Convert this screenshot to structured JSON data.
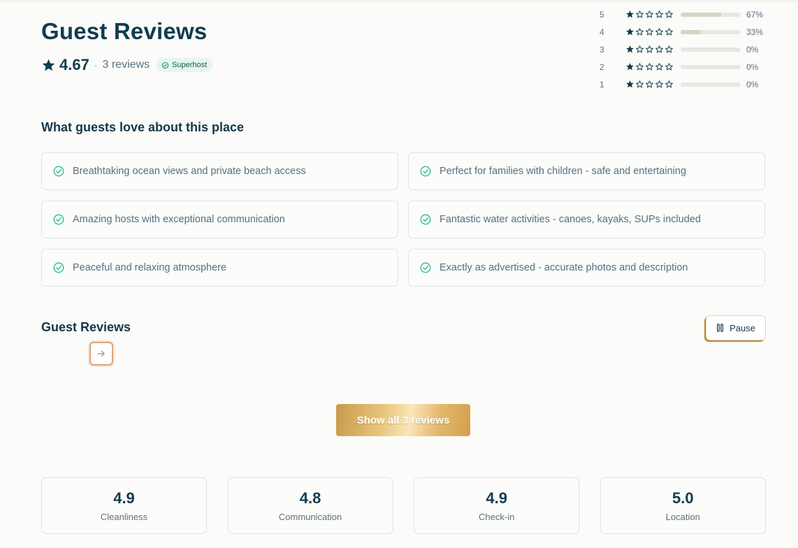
{
  "header": {
    "title": "Guest Reviews",
    "rating": "4.67",
    "separator": "·",
    "reviews_count": "3 reviews",
    "badge": "Superhost"
  },
  "distribution": [
    {
      "stars": "5",
      "percent_label": "67%",
      "fraction": 0.67
    },
    {
      "stars": "4",
      "percent_label": "33%",
      "fraction": 0.33
    },
    {
      "stars": "3",
      "percent_label": "0%",
      "fraction": 0
    },
    {
      "stars": "2",
      "percent_label": "0%",
      "fraction": 0
    },
    {
      "stars": "1",
      "percent_label": "0%",
      "fraction": 0
    }
  ],
  "love": {
    "title": "What guests love about this place",
    "items": [
      "Breathtaking ocean views and private beach access",
      "Perfect for families with children - safe and entertaining",
      "Amazing hosts with exceptional communication",
      "Fantastic water activities - canoes, kayaks, SUPs included",
      "Peaceful and relaxing atmosphere",
      "Exactly as advertised - accurate photos and description"
    ]
  },
  "carousel": {
    "title": "Guest Reviews",
    "pause_label": "Pause",
    "next_icon": "arrow-right-icon"
  },
  "show_all_label": "Show all 3 reviews",
  "categories": [
    {
      "score": "4.9",
      "label": "Cleanliness"
    },
    {
      "score": "4.8",
      "label": "Communication"
    },
    {
      "score": "4.9",
      "label": "Check-in"
    },
    {
      "score": "5.0",
      "label": "Location"
    }
  ],
  "colors": {
    "primary": "#123c4e",
    "accent_green": "#3cbf93",
    "badge_bg": "#e4f6ee",
    "gold": "#d2a04e"
  }
}
